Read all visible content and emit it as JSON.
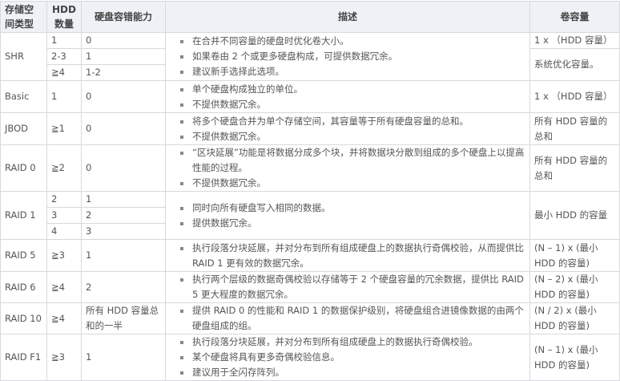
{
  "headers": {
    "type": "存储空间类型",
    "hdd": "HDD 数量",
    "fault": "硬盘容错能力",
    "desc": "描述",
    "capacity": "卷容量"
  },
  "rows": {
    "shr": {
      "name": "SHR",
      "sub": [
        {
          "hdd": "1",
          "fault": "0"
        },
        {
          "hdd": "2-3",
          "fault": "1"
        },
        {
          "hdd": "≧4",
          "fault": "1-2"
        }
      ],
      "desc": [
        "在合并不同容量的硬盘时优化卷大小。",
        "如果卷由 2 个或更多硬盘构成，可提供数据冗余。",
        "建议新手选择此选项。"
      ],
      "capacity1": "1 x （HDD 容量）",
      "capacity2": "系统优化容量。"
    },
    "basic": {
      "name": "Basic",
      "hdd": "1",
      "fault": "0",
      "desc": [
        "单个硬盘构成独立的单位。",
        "不提供数据冗余。"
      ],
      "capacity": "1 x （HDD 容量）"
    },
    "jbod": {
      "name": "JBOD",
      "hdd": "≧1",
      "fault": "0",
      "desc": [
        "将多个硬盘合并为单个存储空间，其容量等于所有硬盘容量的总和。",
        "不提供数据冗余。"
      ],
      "capacity": "所有 HDD 容量的总和"
    },
    "raid0": {
      "name": "RAID 0",
      "hdd": "≧2",
      "fault": "0",
      "desc": [
        "“区块延展”功能是将数据分成多个块，并将数据块分散到组成的多个硬盘上以提高性能的过程。",
        "不提供数据冗余。"
      ],
      "capacity": "所有 HDD 容量的总和"
    },
    "raid1": {
      "name": "RAID 1",
      "sub": [
        {
          "hdd": "2",
          "fault": "1"
        },
        {
          "hdd": "3",
          "fault": "2"
        },
        {
          "hdd": "4",
          "fault": "3"
        }
      ],
      "desc": [
        "同时向所有硬盘写入相同的数据。",
        "提供数据冗余。"
      ],
      "capacity": "最小 HDD 的容量"
    },
    "raid5": {
      "name": "RAID 5",
      "hdd": "≧3",
      "fault": "1",
      "desc": [
        "执行段落分块延展，并对分布到所有组成硬盘上的数据执行奇偶校验，从而提供比 RAID 1 更有效的数据冗余。"
      ],
      "capacity": "(N – 1) x (最小 HDD 的容量)"
    },
    "raid6": {
      "name": "RAID 6",
      "hdd": "≧4",
      "fault": "2",
      "desc": [
        "执行两个层级的数据奇偶校验以存储等于 2 个硬盘容量的冗余数据，提供比 RAID 5 更大程度的数据冗余。"
      ],
      "capacity": "(N – 2) x (最小 HDD 的容量)"
    },
    "raid10": {
      "name": "RAID 10",
      "hdd": "≧4",
      "fault": "所有 HDD 容量总和的一半",
      "desc": [
        "提供 RAID 0 的性能和 RAID 1 的数据保护级别，将硬盘组合进镜像数据的由两个硬盘组成的组。"
      ],
      "capacity": "(N / 2) x (最小 HDD 的容量)"
    },
    "raidf1": {
      "name": "RAID F1",
      "hdd": "≧3",
      "fault": "1",
      "desc": [
        "执行段落分块延展，并对分布到所有组成硬盘上的数据执行奇偶校验。",
        "某个硬盘将具有更多奇偶校验信息。",
        "建议用于全闪存阵列。"
      ],
      "capacity": "(N – 1) x (最小 HDD 的容量)"
    }
  }
}
